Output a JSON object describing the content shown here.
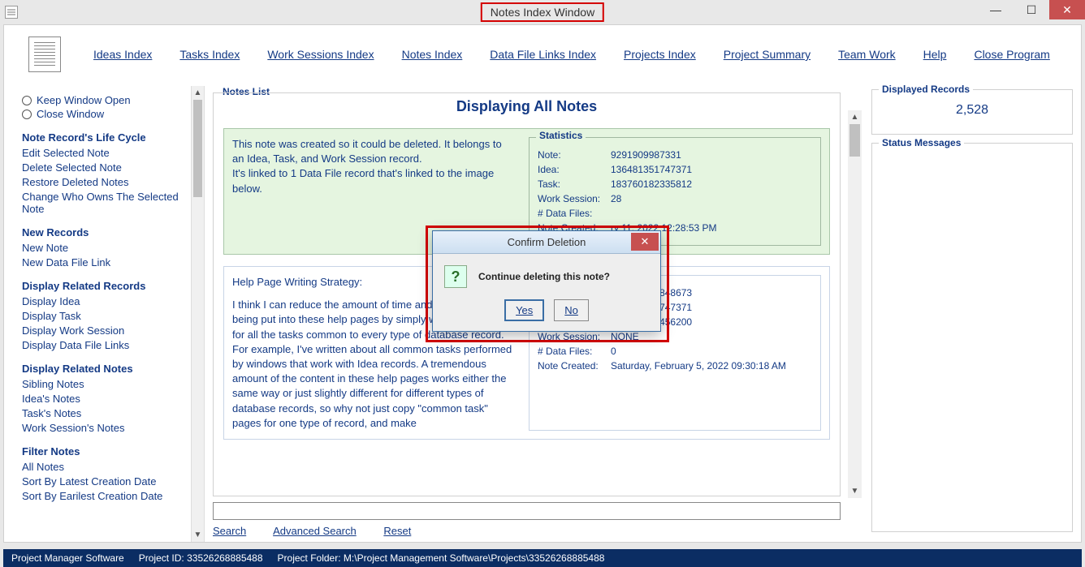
{
  "window": {
    "title": "Notes Index Window"
  },
  "menu": {
    "items": [
      "Ideas Index",
      "Tasks Index",
      "Work Sessions Index",
      "Notes Index",
      "Data File Links Index",
      "Projects Index",
      "Project Summary",
      "Team Work",
      "Help",
      "Close Program"
    ]
  },
  "sidebar": {
    "keep_open": "Keep Window Open",
    "close_window": "Close Window",
    "sections": [
      {
        "heading": "Note Record's Life Cycle",
        "items": [
          "Edit Selected Note",
          "Delete Selected Note",
          "Restore Deleted Notes",
          "Change Who Owns The Selected Note"
        ]
      },
      {
        "heading": "New Records",
        "items": [
          "New Note",
          "New Data File Link"
        ]
      },
      {
        "heading": "Display Related Records",
        "items": [
          "Display Idea",
          "Display Task",
          "Display Work Session",
          "Display Data File Links"
        ]
      },
      {
        "heading": "Display Related Notes",
        "items": [
          "Sibling Notes",
          "Idea's Notes",
          "Task's Notes",
          "Work Session's Notes"
        ]
      },
      {
        "heading": "Filter Notes",
        "items": [
          "All Notes",
          "Sort By Latest Creation Date",
          "Sort By Earilest Creation Date"
        ]
      }
    ]
  },
  "notes_list": {
    "legend": "Notes List",
    "heading": "Displaying All Notes",
    "cards": [
      {
        "text": "This note was created so it could be deleted. It belongs to an Idea, Task, and Work Session record.\nIt's linked to 1 Data File record that's linked to the image below.",
        "stats_legend": "Statistics",
        "stats": [
          {
            "k": "Note:",
            "v": "9291909987331"
          },
          {
            "k": "Idea:",
            "v": "136481351747371"
          },
          {
            "k": "Task:",
            "v": "183760182335812"
          },
          {
            "k": "Work Session:",
            "v": "28"
          },
          {
            "k": "# Data Files:",
            "v": ""
          },
          {
            "k": "Note Created:",
            "v": "ry 11, 2022   12:28:53 PM"
          }
        ]
      },
      {
        "title": "Help Page Writing Strategy:",
        "text": "I think I can reduce the amount of time and work that's being put into these help pages by simply writing tutorials for all the tasks common to every type of database record. For example, I've written about all common tasks performed by windows that work with Idea records. A tremendous amount of the content in these help pages works either the same way or just slightly different for different types of database records, so why not just copy \"common task\" pages for one type of record, and make",
        "stats_legend": "",
        "stats": [
          {
            "k": "Note:",
            "v": "214860961848673"
          },
          {
            "k": "Idea:",
            "v": "136481351747371"
          },
          {
            "k": "Task:",
            "v": "183670818456200"
          },
          {
            "k": "Work Session:",
            "v": "NONE"
          },
          {
            "k": "# Data Files:",
            "v": "0"
          },
          {
            "k": "Note Created:",
            "v": "Saturday, February 5, 2022   09:30:18 AM"
          }
        ]
      }
    ]
  },
  "search": {
    "search": "Search",
    "advanced": "Advanced Search",
    "reset": "Reset",
    "placeholder": ""
  },
  "right": {
    "displayed_legend": "Displayed Records",
    "displayed_value": "2,528",
    "status_legend": "Status Messages"
  },
  "dialog": {
    "title": "Confirm Deletion",
    "message": "Continue deleting this note?",
    "yes": "Yes",
    "no": "No"
  },
  "statusbar": {
    "app": "Project Manager Software",
    "project_id_label": "Project ID:",
    "project_id": "33526268885488",
    "folder_label": "Project Folder:",
    "folder": "M:\\Project Management Software\\Projects\\33526268885488"
  }
}
